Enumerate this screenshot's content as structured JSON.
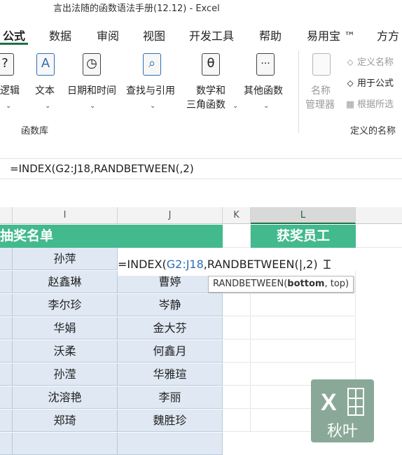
{
  "window": {
    "title": "言出法随的函数语法手册(12.12)  -  Excel"
  },
  "tabs": [
    {
      "label": "公式",
      "active": true
    },
    {
      "label": "数据"
    },
    {
      "label": "审阅"
    },
    {
      "label": "视图"
    },
    {
      "label": "开发工具"
    },
    {
      "label": "帮助"
    },
    {
      "label": "易用宝 ™"
    },
    {
      "label": "方方"
    }
  ],
  "ribbon": {
    "function_library": {
      "group_label": "函数库",
      "buttons": [
        {
          "label": "逻辑",
          "icon": "logical-icon",
          "glyph": "?"
        },
        {
          "label": "文本",
          "icon": "text-icon",
          "glyph": "A"
        },
        {
          "label": "日期和时间",
          "icon": "clock-icon",
          "glyph": "◷"
        },
        {
          "label": "查找与引用",
          "icon": "magnifier-icon",
          "glyph": "⌕"
        },
        {
          "label": "数学和",
          "label2": "三角函数",
          "icon": "theta-icon",
          "glyph": "θ"
        },
        {
          "label": "其他函数",
          "icon": "more-functions-icon",
          "glyph": "···"
        }
      ]
    },
    "defined_names": {
      "group_label": "定义的名称",
      "name_manager": {
        "label": "名称",
        "label2": "管理器",
        "icon": "name-tag-icon"
      },
      "items": [
        {
          "label": "定义名称",
          "icon": "tag-icon"
        },
        {
          "label": "用于公式",
          "icon": "formula-tag-icon"
        },
        {
          "label": "根据所选",
          "icon": "grid-select-icon"
        }
      ]
    }
  },
  "formula_bar": {
    "text": "=INDEX(G2:J18,RANDBETWEEN(,2)"
  },
  "columns": [
    {
      "letter": "I"
    },
    {
      "letter": "J"
    },
    {
      "letter": "K"
    },
    {
      "letter": "L",
      "selected": true
    }
  ],
  "sheet": {
    "left_banner": "抽奖名单",
    "right_banner": "获奖员工",
    "rows": [
      {
        "i": "孙萍",
        "j": ""
      },
      {
        "i": "赵鑫琳",
        "j": "曹婷"
      },
      {
        "i": "李尔珍",
        "j": "岑静"
      },
      {
        "i": "华娟",
        "j": "金大芬"
      },
      {
        "i": "沃柔",
        "j": "何鑫月"
      },
      {
        "i": "孙滢",
        "j": "华雅瑄"
      },
      {
        "i": "沈溶艳",
        "j": "李丽"
      },
      {
        "i": "郑琦",
        "j": "魏胜珍"
      }
    ],
    "editing": {
      "prefix": "=INDEX(",
      "ref": "G2:J18",
      "suffix": ",RANDBETWEEN(",
      "caret": "|",
      "tail": ",2)"
    }
  },
  "tooltip": {
    "func": "RANDBETWEEN(",
    "bold_arg": "bottom",
    "rest": ", top)"
  },
  "watermark": {
    "text": "秋叶"
  }
}
